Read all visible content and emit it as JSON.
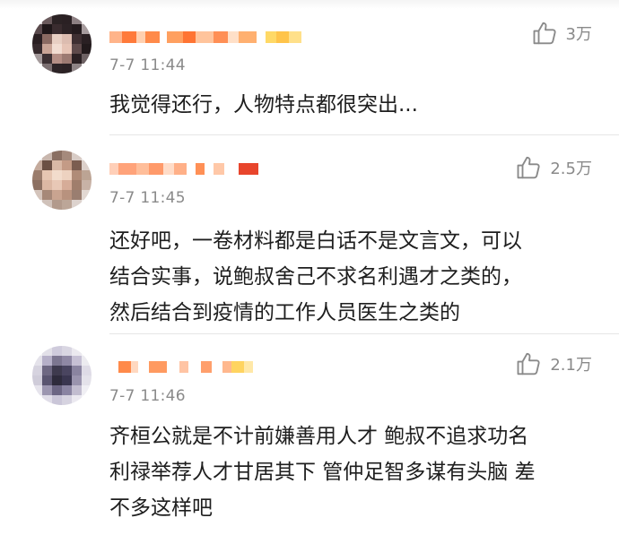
{
  "comments": [
    {
      "time": "7-7 11:44",
      "likes": "3万",
      "text": "我觉得还行，人物特点都很突出..."
    },
    {
      "time": "7-7 11:45",
      "likes": "2.5万",
      "text": "还好吧，一卷材料都是白话不是文言文，可以\n结合实事，说鲍叔舍己不求名利遇才之类的，\n然后结合到疫情的工作人员医生之类的"
    },
    {
      "time": "7-7 11:46",
      "likes": "2.1万",
      "text": "齐桓公就是不计前嫌善用人才 鲍叔不追求功名\n利禄举荐人才甘居其下 管仲足智多谋有头脑 差\n不多这样吧"
    }
  ],
  "icons": {
    "like": "thumbs-up-icon"
  },
  "colors": {
    "secondary_text": "#8a8a8a",
    "name_orange": "#ff8a3c",
    "name_red": "#e8452c",
    "name_yellow": "#ffcc33"
  }
}
